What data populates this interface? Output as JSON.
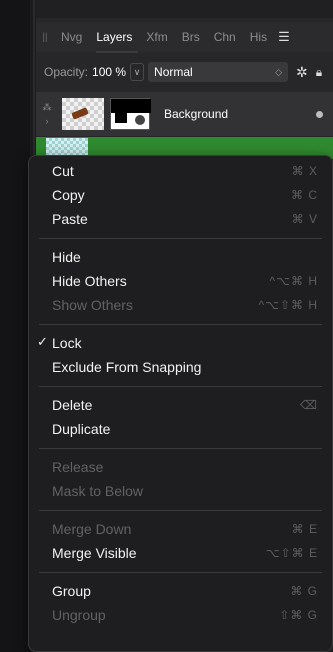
{
  "tabs": [
    {
      "label": "Nvg",
      "active": false
    },
    {
      "label": "Layers",
      "active": true
    },
    {
      "label": "Xfm",
      "active": false
    },
    {
      "label": "Brs",
      "active": false
    },
    {
      "label": "Chn",
      "active": false
    },
    {
      "label": "His",
      "active": false
    }
  ],
  "opacity": {
    "label": "Opacity:",
    "value": "100 %"
  },
  "blend": {
    "value": "Normal"
  },
  "layer": {
    "name": "Background"
  },
  "menu": {
    "cut": {
      "label": "Cut",
      "shortcut": "⌘ X"
    },
    "copy": {
      "label": "Copy",
      "shortcut": "⌘ C"
    },
    "paste": {
      "label": "Paste",
      "shortcut": "⌘ V"
    },
    "hide": {
      "label": "Hide"
    },
    "hide_others": {
      "label": "Hide Others",
      "shortcut": "^⌥⌘ H"
    },
    "show_others": {
      "label": "Show Others",
      "shortcut": "^⌥⇧⌘ H"
    },
    "lock": {
      "label": "Lock",
      "check": "✓"
    },
    "exclude_snapping": {
      "label": "Exclude From Snapping"
    },
    "delete": {
      "label": "Delete",
      "shortcut": "⌫"
    },
    "duplicate": {
      "label": "Duplicate"
    },
    "release": {
      "label": "Release"
    },
    "mask_below": {
      "label": "Mask to Below"
    },
    "merge_down": {
      "label": "Merge Down",
      "shortcut": "⌘ E"
    },
    "merge_visible": {
      "label": "Merge Visible",
      "shortcut": "⌥⇧⌘ E"
    },
    "group": {
      "label": "Group",
      "shortcut": "⌘ G"
    },
    "ungroup": {
      "label": "Ungroup",
      "shortcut": "⇧⌘ G"
    }
  }
}
